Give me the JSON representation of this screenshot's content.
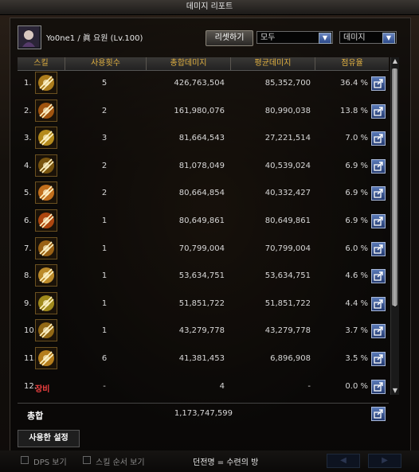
{
  "window": {
    "title": "데미지 리포트"
  },
  "player": {
    "name": "Yo0ne1",
    "separator": "/",
    "class_label": "眞 요원 (Lv.100)"
  },
  "controls": {
    "reset_label": "리셋하기",
    "filter_value": "모두",
    "metric_value": "데미지"
  },
  "columns": {
    "skill": "스킬",
    "use_count": "사용횟수",
    "total_damage": "총합데미지",
    "avg_damage": "평균데미지",
    "share": "점유율"
  },
  "rows": [
    {
      "idx": "1.",
      "icon": "skill-1-icon",
      "count": "5",
      "total": "426,763,504",
      "avg": "85,352,700",
      "share": "36.4 %"
    },
    {
      "idx": "2.",
      "icon": "skill-2-icon",
      "count": "2",
      "total": "161,980,076",
      "avg": "80,990,038",
      "share": "13.8 %"
    },
    {
      "idx": "3.",
      "icon": "skill-3-icon",
      "count": "3",
      "total": "81,664,543",
      "avg": "27,221,514",
      "share": "7.0 %"
    },
    {
      "idx": "4.",
      "icon": "skill-4-icon",
      "count": "2",
      "total": "81,078,049",
      "avg": "40,539,024",
      "share": "6.9 %"
    },
    {
      "idx": "5.",
      "icon": "skill-5-icon",
      "count": "2",
      "total": "80,664,854",
      "avg": "40,332,427",
      "share": "6.9 %"
    },
    {
      "idx": "6.",
      "icon": "skill-6-icon",
      "count": "1",
      "total": "80,649,861",
      "avg": "80,649,861",
      "share": "6.9 %"
    },
    {
      "idx": "7.",
      "icon": "skill-7-icon",
      "count": "1",
      "total": "70,799,004",
      "avg": "70,799,004",
      "share": "6.0 %"
    },
    {
      "idx": "8.",
      "icon": "skill-8-icon",
      "count": "1",
      "total": "53,634,751",
      "avg": "53,634,751",
      "share": "4.6 %"
    },
    {
      "idx": "9.",
      "icon": "skill-9-icon",
      "count": "1",
      "total": "51,851,722",
      "avg": "51,851,722",
      "share": "4.4 %"
    },
    {
      "idx": "10.",
      "icon": "skill-10-icon",
      "count": "1",
      "total": "43,279,778",
      "avg": "43,279,778",
      "share": "3.7 %"
    },
    {
      "idx": "11.",
      "icon": "skill-11-icon",
      "count": "6",
      "total": "41,381,453",
      "avg": "6,896,908",
      "share": "3.5 %"
    },
    {
      "idx": "12.",
      "label": "장비",
      "count": "-",
      "total": "4",
      "avg": "-",
      "share": "0.0 %"
    }
  ],
  "total": {
    "label": "총합",
    "value": "1,173,747,599"
  },
  "settings_tab": "사용한 설정",
  "footer": {
    "dps_label": "DPS 보기",
    "skill_order_label": "스킬 순서 보기",
    "dungeon": "던전명 = 수련의 방"
  },
  "colors": {
    "header_text": "#e0b040",
    "equip_text": "#f04040",
    "share_button": "#3a5a98"
  }
}
